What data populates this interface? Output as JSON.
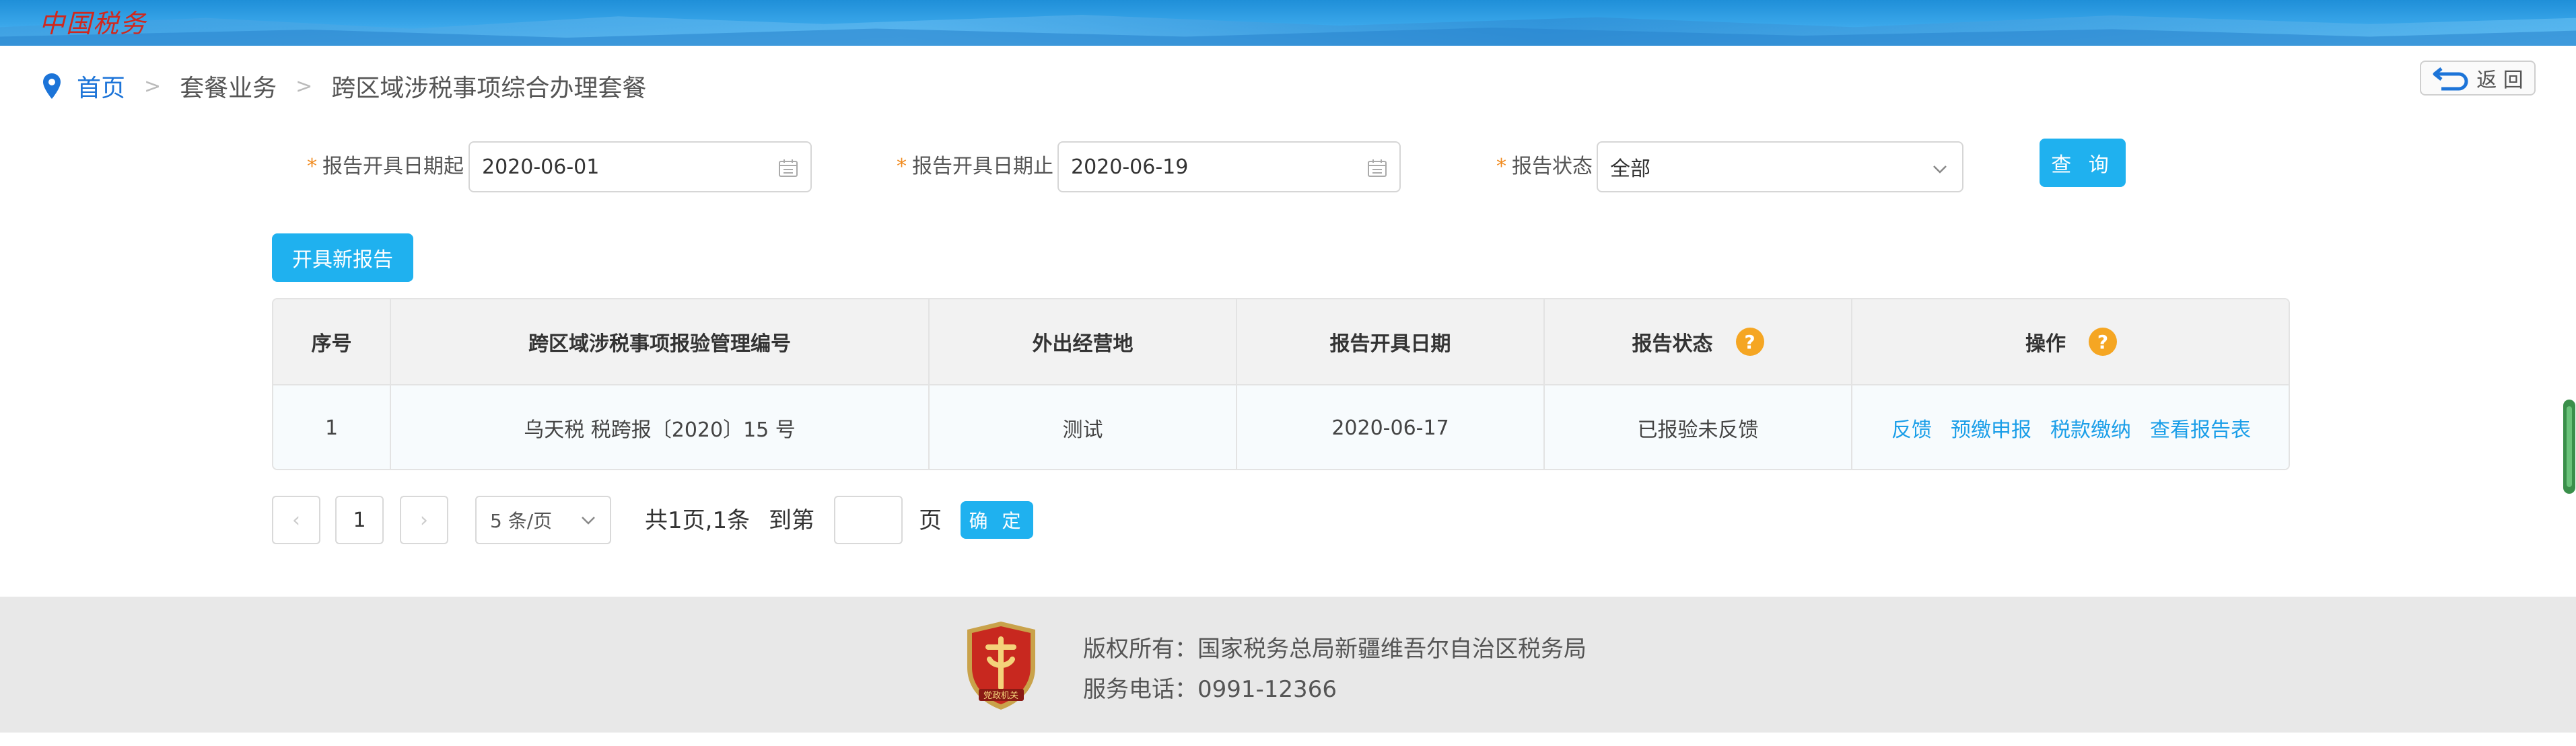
{
  "header": {
    "logo_text": "中国税务"
  },
  "breadcrumb": {
    "home": "首页",
    "separator": ">",
    "level1": "套餐业务",
    "level2": "跨区域涉税事项综合办理套餐"
  },
  "back_button": {
    "label": "返 回"
  },
  "filters": {
    "required_mark": "*",
    "start_date_label": "报告开具日期起",
    "start_date_value": "2020-06-01",
    "end_date_label": "报告开具日期止",
    "end_date_value": "2020-06-19",
    "status_label": "报告状态",
    "status_value": "全部",
    "query_label": "查 询"
  },
  "new_report_label": "开具新报告",
  "table": {
    "headers": [
      "序号",
      "跨区域涉税事项报验管理编号",
      "外出经营地",
      "报告开具日期",
      "报告状态",
      "操作"
    ],
    "help_mark": "?",
    "rows": [
      {
        "index": "1",
        "code": "乌天税 税跨报〔2020〕15 号",
        "location": "测试",
        "date": "2020-06-17",
        "status": "已报验未反馈",
        "actions": [
          "反馈",
          "预缴申报",
          "税款缴纳",
          "查看报告表"
        ]
      }
    ]
  },
  "pagination": {
    "prev": "‹",
    "current_page": "1",
    "next": "›",
    "page_size": "5 条/页",
    "total_text": "共1页,1条",
    "goto_label": "到第",
    "page_unit": "页",
    "confirm_label": "确 定"
  },
  "footer": {
    "copyright": "版权所有：国家税务总局新疆维吾尔自治区税务局",
    "phone": "服务电话：0991-12366",
    "badge_text": "党政机关"
  },
  "colors": {
    "primary": "#1fb1ef",
    "link": "#1a9ee8",
    "breadcrumb_home": "#1c74d8",
    "help": "#f5a623",
    "required": "#f08a1e"
  }
}
